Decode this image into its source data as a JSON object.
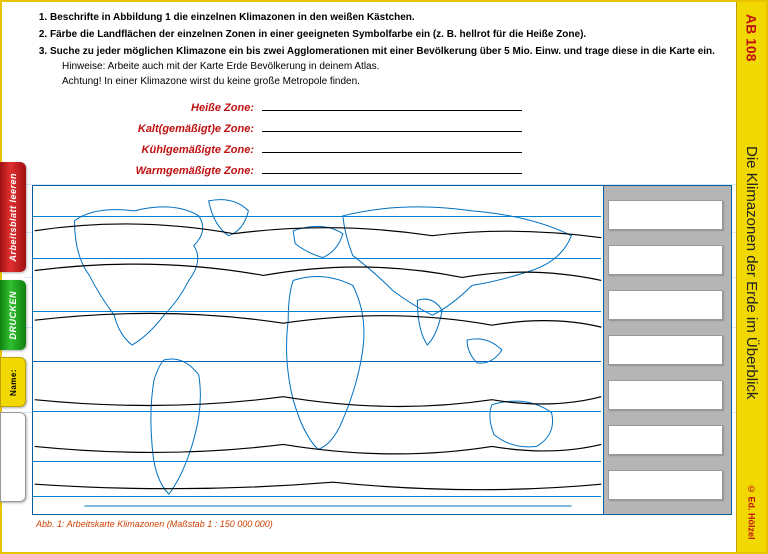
{
  "sidebar": {
    "tab_clear": "Arbeitsblatt leeren",
    "tab_print": "DRUCKEN",
    "tab_name_label": "Name:"
  },
  "right": {
    "code": "AB 108",
    "title": "Die Klimazonen der Erde im Überblick",
    "publisher": "© Ed. Hölzel"
  },
  "instructions": {
    "item1": "Beschrifte in Abbildung 1 die einzelnen Klimazonen in den weißen Kästchen.",
    "item2": "Färbe die Landflächen der einzelnen Zonen in einer geeigneten Symbolfarbe ein (z. B. hellrot für die Heiße Zone).",
    "item3": "Suche zu jeder möglichen Klimazone ein bis zwei Agglomerationen mit einer Bevölkerung über 5 Mio. Einw. und trage diese in die Karte ein.",
    "hint1": "Hinweise: Arbeite auch mit der Karte Erde Bevölkerung in deinem Atlas.",
    "hint2": "Achtung! In einer Klimazone wirst du keine große Metropole finden."
  },
  "zones": {
    "z1": "Heiße Zone:",
    "z2": "Kalt(gemäßigt)e Zone:",
    "z3": "Kühlgemäßigte Zone:",
    "z4": "Warmgemäßigte Zone:"
  },
  "caption": "Abb. 1: Arbeitskarte Klimazonen (Maßstab 1 : 150 000 000)",
  "label_boxes": [
    "",
    "",
    "",
    "",
    "",
    "",
    ""
  ]
}
